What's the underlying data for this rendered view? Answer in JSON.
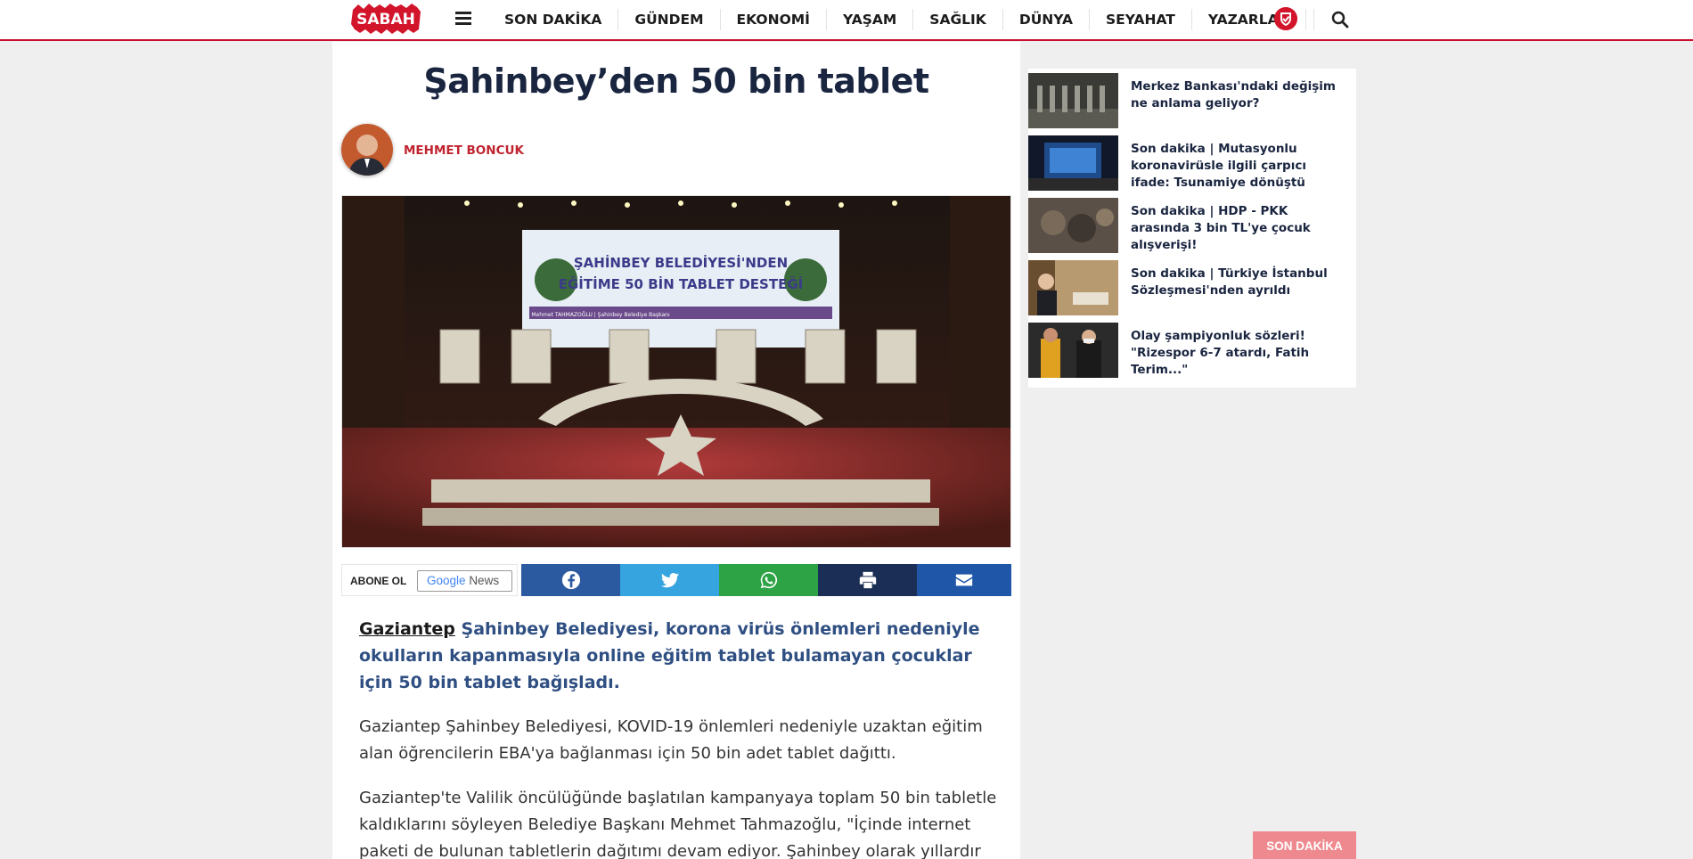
{
  "header": {
    "logo_text": "SABAH",
    "nav_items": [
      "SON DAKİKA",
      "GÜNDEM",
      "EKONOMİ",
      "YAŞAM",
      "SAĞLIK",
      "DÜNYA",
      "SEYAHAT",
      "YAZARLAR"
    ],
    "colors": {
      "brand": "#c8102e",
      "shield": "#d3152b"
    },
    "icons": [
      "hamburger-icon",
      "shield-icon",
      "search-icon"
    ]
  },
  "article": {
    "title": "Şahinbey’den 50 bin tablet",
    "author": "MEHMET BONCUK",
    "hero_banner_line1": "ŞAHİNBEY BELEDİYESİ'NDEN",
    "hero_banner_line2": "EĞİTİME 50 BİN TABLET DESTEĞİ",
    "hero_banner_sub": "Mehmet TAHMAZOĞLU | Şahinbey Belediye Başkanı",
    "share": {
      "abone_label": "ABONE OL",
      "google": "Google",
      "news": "News",
      "buttons": [
        {
          "name": "facebook",
          "color": "#2c5aa0"
        },
        {
          "name": "twitter",
          "color": "#35a4df"
        },
        {
          "name": "whatsapp",
          "color": "#2ea346"
        },
        {
          "name": "print",
          "color": "#1b2e55"
        },
        {
          "name": "email",
          "color": "#1f56a8"
        }
      ]
    },
    "lead_link": "Gaziantep",
    "lead_text": " Şahinbey Belediyesi, korona virüs önlemleri nedeniyle okulların kapanmasıyla online eğitim tablet bulamayan çocuklar için 50 bin tablet bağışladı.",
    "paragraphs": [
      "Gaziantep Şahinbey Belediyesi, KOVID-19 önlemleri nedeniyle uzaktan eğitim alan öğrencilerin EBA'ya bağlanması için 50 bin adet tablet dağıttı.",
      "Gaziantep'te Valilik öncülüğünde başlatılan kampanyaya toplam 50 bin tabletle kaldıklarını söyleyen Belediye Başkanı Mehmet Tahmazoğlu, \"İçinde internet paketi de bulunan tabletlerin dağıtımı devam ediyor. Şahinbey olarak yıllardır"
    ]
  },
  "sidebar": {
    "items": [
      {
        "text": "Merkez Bankası'ndaki değişim ne anlama geliyor?"
      },
      {
        "text": "Son dakika | Mutasyonlu koronavirüsle ilgili çarpıcı ifade: Tsunamiye dönüştü"
      },
      {
        "text": "Son dakika | HDP - PKK arasında 3 bin TL'ye çocuk alışverişi!"
      },
      {
        "text": "Son dakika | Türkiye İstanbul Sözleşmesi'nden ayrıldı"
      },
      {
        "text": "Olay şampiyonluk sözleri! \"Rizespor 6-7 atardı, Fatih Terim...\""
      }
    ]
  },
  "floating": {
    "son_dakika_label": "SON DAKİKA"
  }
}
